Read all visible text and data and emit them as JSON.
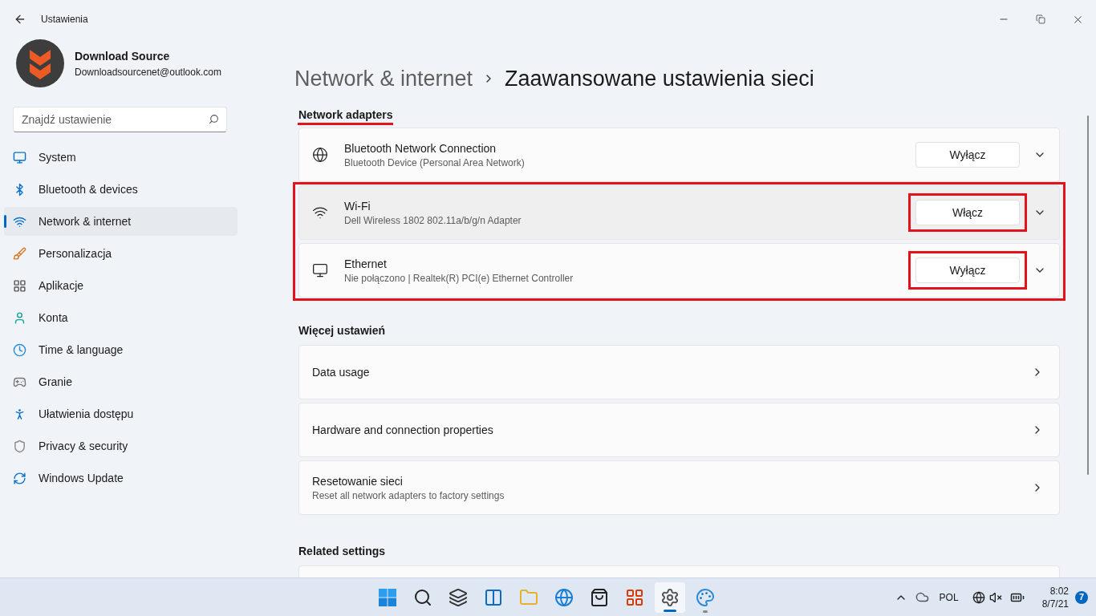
{
  "window": {
    "title": "Ustawienia"
  },
  "account": {
    "name": "Download Source",
    "email": "Downloadsourcenet@outlook.com"
  },
  "search": {
    "placeholder": "Znajdź ustawienie"
  },
  "sidebar": {
    "items": [
      {
        "label": "System",
        "selected": false
      },
      {
        "label": "Bluetooth & devices",
        "selected": false
      },
      {
        "label": "Network & internet",
        "selected": true
      },
      {
        "label": "Personalizacja",
        "selected": false
      },
      {
        "label": "Aplikacje",
        "selected": false
      },
      {
        "label": "Konta",
        "selected": false
      },
      {
        "label": "Time & language",
        "selected": false
      },
      {
        "label": "Granie",
        "selected": false
      },
      {
        "label": "Ułatwienia dostępu",
        "selected": false
      },
      {
        "label": "Privacy & security",
        "selected": false
      },
      {
        "label": "Windows Update",
        "selected": false
      }
    ]
  },
  "breadcrumb": {
    "parent": "Network & internet",
    "current": "Zaawansowane ustawienia sieci"
  },
  "network_adapters": {
    "heading": "Network adapters",
    "underlined": true,
    "adapters": [
      {
        "name": "Bluetooth Network Connection",
        "description": "Bluetooth Device (Personal Area Network)",
        "button": "Wyłącz",
        "hovered": false,
        "boxed": false,
        "button_boxed": false
      },
      {
        "name": "Wi-Fi",
        "description": "Dell Wireless 1802 802.11a/b/g/n Adapter",
        "button": "Włącz",
        "hovered": true,
        "boxed": true,
        "button_boxed": true
      },
      {
        "name": "Ethernet",
        "description": "Nie połączono | Realtek(R) PCI(e) Ethernet Controller",
        "button": "Wyłącz",
        "hovered": false,
        "boxed": true,
        "button_boxed": true
      }
    ]
  },
  "more_settings": {
    "heading": "Więcej ustawień",
    "items": [
      {
        "title": "Data usage"
      },
      {
        "title": "Hardware and connection properties"
      },
      {
        "title": "Resetowanie sieci",
        "subtitle": "Reset all network adapters to factory settings"
      }
    ]
  },
  "related_settings": {
    "heading": "Related settings"
  },
  "taskbar": {
    "apps": [
      {
        "active": false,
        "running": false
      },
      {
        "active": false,
        "running": false
      },
      {
        "active": false,
        "running": false
      },
      {
        "active": false,
        "running": false
      },
      {
        "active": false,
        "running": false
      },
      {
        "active": false,
        "running": false
      },
      {
        "active": false,
        "running": false
      },
      {
        "active": false,
        "running": false
      },
      {
        "active": true,
        "running": true
      },
      {
        "active": false,
        "running": true
      }
    ],
    "language": "POL",
    "time": "8:02",
    "date": "8/7/21",
    "notifications": "7"
  }
}
